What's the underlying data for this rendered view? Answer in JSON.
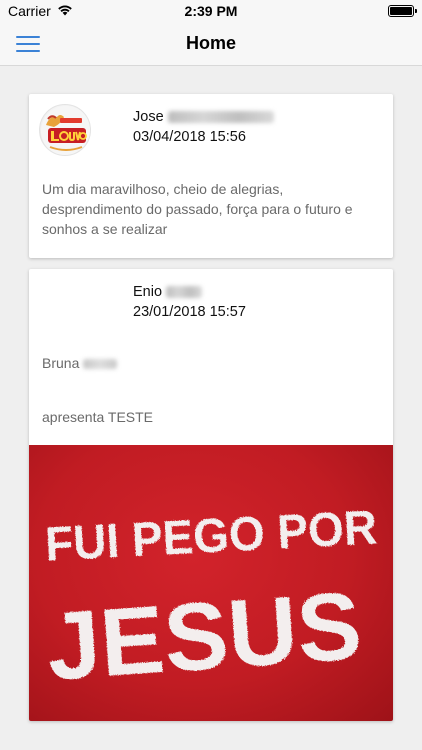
{
  "status_bar": {
    "carrier": "Carrier",
    "time": "2:39 PM",
    "wifi_icon": "wifi-icon",
    "battery_icon": "battery-icon",
    "battery_level": 1.0
  },
  "nav": {
    "title": "Home",
    "menu_icon": "hamburger-menu-icon",
    "accent_color": "#3b82d6"
  },
  "posts": [
    {
      "author_first": "Jose",
      "date": "03/04/2018 15:56",
      "avatar_logo_text": "LOUVOR",
      "message": "Um dia maravilhoso, cheio de alegrias, desprendimento do passado, força para o futuro e sonhos a se realizar"
    },
    {
      "author_first": "Enio",
      "date": "23/01/2018 15:57",
      "mention_first": "Bruna",
      "presents_text": "apresenta TESTE",
      "image_text_line1": "FUI PEGO POR",
      "image_text_line2": "JESUS",
      "image_bg_color": "#c11c23"
    }
  ]
}
